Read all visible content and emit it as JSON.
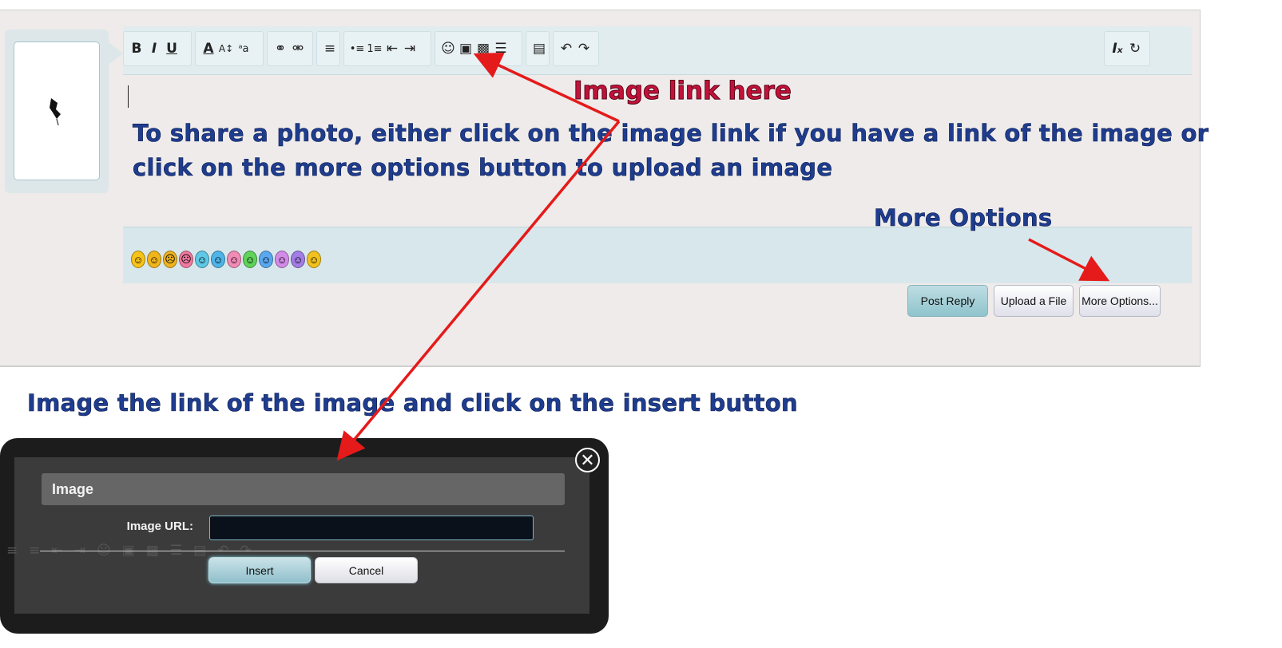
{
  "reply_form": {
    "toolbar": {
      "group1": [
        "B",
        "I",
        "U"
      ],
      "group2": [
        "A",
        "A↕",
        "ᵃa"
      ],
      "group3": [
        "⚭",
        "⚮"
      ],
      "group4": [
        "≡"
      ],
      "group5": [
        "•≡",
        "1≡",
        "⇤",
        "⇥"
      ],
      "group6": [
        "☺",
        "▣",
        "▩",
        "☰"
      ],
      "group7": [
        "▤"
      ],
      "group8": [
        "↶",
        "↷"
      ],
      "right": [
        "Iₓ",
        "↻"
      ]
    },
    "smilies": [
      "☺",
      "☺",
      "☹",
      "☹",
      "☺",
      "☺",
      "☺",
      "☺",
      "☺",
      "☺",
      "☺",
      "☺"
    ],
    "buttons": {
      "post_reply": "Post Reply",
      "upload_file": "Upload a File",
      "more_options": "More Options..."
    }
  },
  "annotations": {
    "image_link_here": "Image link here",
    "share_line1": "To share a photo, either click on the image link if you have a link of the image or",
    "share_line2": "click on the more options button to upload an image",
    "more_options": "More Options",
    "instruction": "Image the link of the image and click on the insert button"
  },
  "dialog": {
    "title": "Image",
    "url_label": "Image URL:",
    "url_value": "",
    "insert": "Insert",
    "cancel": "Cancel",
    "close_icon": "✕"
  },
  "colors": {
    "annotation_red": "#c2123a",
    "annotation_blue": "#1f3d8f",
    "arrow": "#e51a1a"
  }
}
